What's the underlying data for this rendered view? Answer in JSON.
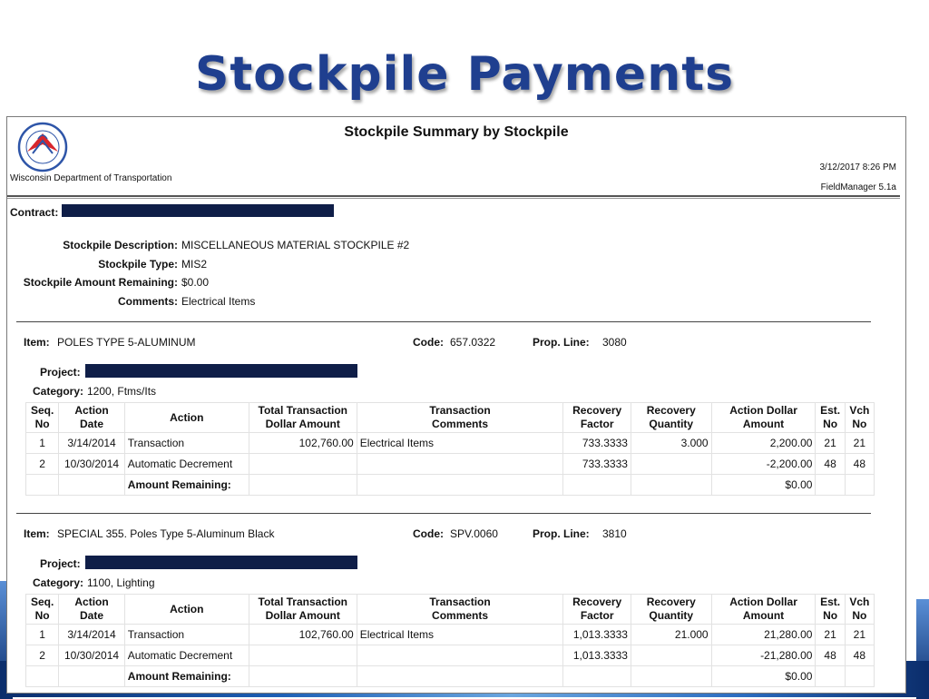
{
  "slide": {
    "title": "Stockpile Payments"
  },
  "report": {
    "title": "Stockpile Summary by Stockpile",
    "organization": "Wisconsin Department of Transportation",
    "date_time": "3/12/2017 8:26 PM",
    "app_version": "FieldManager 5.1a",
    "contract_label": "Contract:",
    "stockpile": {
      "description_label": "Stockpile Description:",
      "description": "MISCELLANEOUS MATERIAL STOCKPILE #2",
      "type_label": "Stockpile Type:",
      "type": "MIS2",
      "amount_remaining_label": "Stockpile Amount Remaining:",
      "amount_remaining": "$0.00",
      "comments_label": "Comments:",
      "comments": "Electrical Items"
    },
    "columns": {
      "seq_1": "Seq.",
      "seq_2": "No",
      "action_date_1": "Action",
      "action_date_2": "Date",
      "action": "Action",
      "total_1": "Total Transaction",
      "total_2": "Dollar Amount",
      "comments_1": "Transaction",
      "comments_2": "Comments",
      "factor_1": "Recovery",
      "factor_2": "Factor",
      "qty_1": "Recovery",
      "qty_2": "Quantity",
      "amount_1": "Action Dollar",
      "amount_2": "Amount",
      "est_1": "Est.",
      "est_2": "No",
      "vch_1": "Vch",
      "vch_2": "No"
    },
    "items": [
      {
        "item_label": "Item:",
        "item": "POLES TYPE 5-ALUMINUM",
        "code_label": "Code:",
        "code": "657.0322",
        "prop_line_label": "Prop. Line:",
        "prop_line": "3080",
        "project_label": "Project:",
        "category_label": "Category:",
        "category": "1200, Ftms/Its",
        "rows": [
          {
            "seq": "1",
            "date": "3/14/2014",
            "action": "Transaction",
            "total": "102,760.00",
            "comments": "Electrical Items",
            "factor": "733.3333",
            "qty": "3.000",
            "amount": "2,200.00",
            "est": "21",
            "vch": "21"
          },
          {
            "seq": "2",
            "date": "10/30/2014",
            "action": "Automatic Decrement",
            "total": "",
            "comments": "",
            "factor": "733.3333",
            "qty": "",
            "amount": "-2,200.00",
            "est": "48",
            "vch": "48"
          }
        ],
        "remaining_label": "Amount Remaining:",
        "remaining": "$0.00"
      },
      {
        "item_label": "Item:",
        "item": "SPECIAL 355. Poles Type 5-Aluminum Black",
        "code_label": "Code:",
        "code": "SPV.0060",
        "prop_line_label": "Prop. Line:",
        "prop_line": "3810",
        "project_label": "Project:",
        "category_label": "Category:",
        "category": "1100, Lighting",
        "rows": [
          {
            "seq": "1",
            "date": "3/14/2014",
            "action": "Transaction",
            "total": "102,760.00",
            "comments": "Electrical Items",
            "factor": "1,013.3333",
            "qty": "21.000",
            "amount": "21,280.00",
            "est": "21",
            "vch": "21"
          },
          {
            "seq": "2",
            "date": "10/30/2014",
            "action": "Automatic Decrement",
            "total": "",
            "comments": "",
            "factor": "1,013.3333",
            "qty": "",
            "amount": "-21,280.00",
            "est": "48",
            "vch": "48"
          }
        ],
        "remaining_label": "Amount Remaining:",
        "remaining": "$0.00"
      }
    ]
  }
}
